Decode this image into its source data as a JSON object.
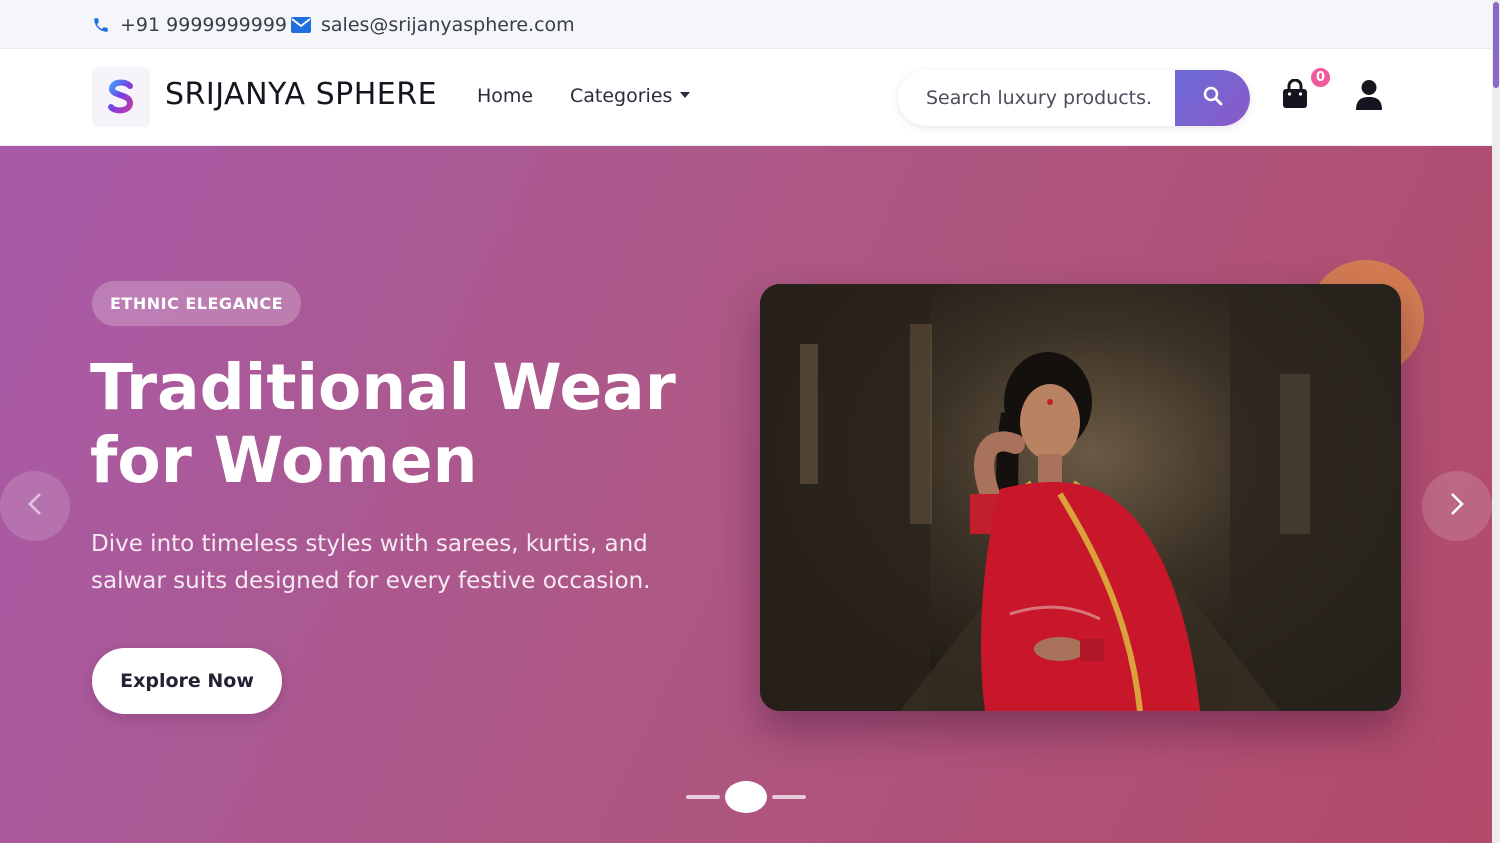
{
  "topbar": {
    "phone": "+91 9999999999",
    "email": "sales@srijanyasphere.com",
    "phone_icon": "phone-icon",
    "email_icon": "envelope-icon"
  },
  "header": {
    "logo_icon": "brand-s-logo",
    "brand": "SRIJANYA SPHERE",
    "nav": {
      "home": "Home",
      "categories": "Categories"
    },
    "search": {
      "placeholder": "Search luxury products.",
      "button_icon": "search-icon"
    },
    "cart": {
      "icon": "shopping-bag-icon",
      "count": "0"
    },
    "user_icon": "user-icon"
  },
  "hero": {
    "tag": "ETHNIC ELEGANCE",
    "title_line1": "Traditional Wear",
    "title_line2": "for Women",
    "description_line1": "Dive into timeless styles with sarees, kurtis, and",
    "description_line2": "salwar suits designed for every festive occasion.",
    "cta": "Explore Now",
    "prev_icon": "chevron-left-icon",
    "next_icon": "chevron-right-icon",
    "slides_total": 3,
    "active_slide": 2
  },
  "colors": {
    "accent": "#6b6ad6",
    "badge": "#ee5a9a",
    "hero_start": "#a85aa9",
    "hero_end": "#b24a6a",
    "decor_circle": "#d9824e"
  }
}
